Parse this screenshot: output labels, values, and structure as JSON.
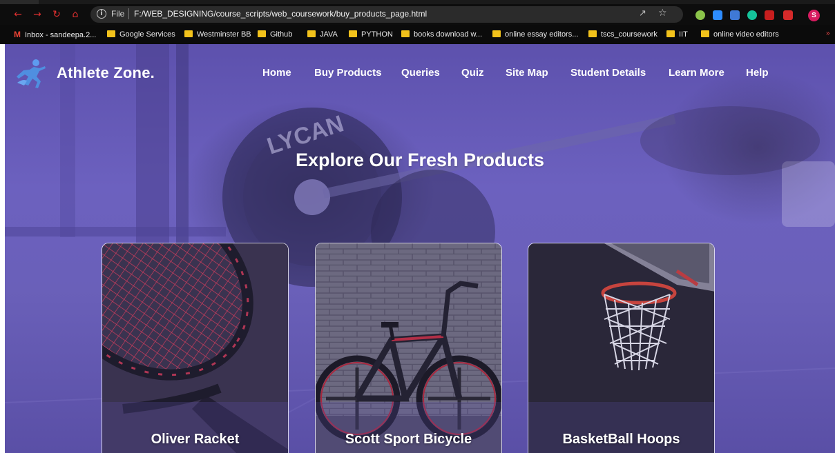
{
  "browser": {
    "scheme_label": "File",
    "url": "F:/WEB_DESIGNING/course_scripts/web_coursework/buy_products_page.html",
    "profile_initial": "S",
    "bookmarks": [
      "Inbox - sandeepa.2...",
      "Google Services",
      "Westminster BB",
      "Github",
      "JAVA",
      "PYTHON",
      "books download w...",
      "online essay editors...",
      "tscs_coursework",
      "IIT",
      "online video editors"
    ],
    "extension_icons": [
      "grammarly-icon",
      "zoom-icon",
      "screen-capture-icon",
      "grammar-check-icon",
      "adblock-icon",
      "extension-red-icon"
    ]
  },
  "site": {
    "brand": "Athlete Zone.",
    "nav": [
      "Home",
      "Buy Products",
      "Queries",
      "Quiz",
      "Site Map",
      "Student Details",
      "Learn More",
      "Help"
    ],
    "hero_title": "Explore Our Fresh Products",
    "products": [
      {
        "name": "Oliver Racket"
      },
      {
        "name": "Scott Sport Bicycle"
      },
      {
        "name": "BasketBall Hoops"
      }
    ]
  },
  "colors": {
    "overlay_purple": "#6a5fbd",
    "brand_text": "#ffffff",
    "logo_blue": "#4f8fe0",
    "browser_nav_red": "#e03030",
    "bookmark_folder": "#f2c21b"
  }
}
